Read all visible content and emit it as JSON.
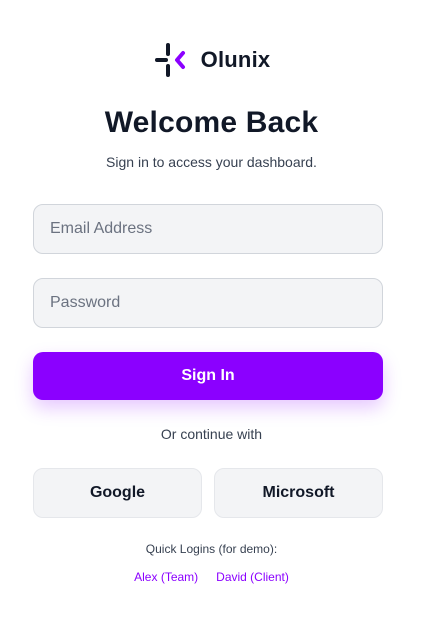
{
  "brand": {
    "name": "Olunix",
    "logo_icon": "plus-bracket-logo-icon",
    "accent_color": "#8B00FF"
  },
  "header": {
    "title": "Welcome Back",
    "subtitle": "Sign in to access your dashboard."
  },
  "form": {
    "email": {
      "value": "",
      "placeholder": "Email Address"
    },
    "password": {
      "value": "",
      "placeholder": "Password"
    },
    "submit_label": "Sign In",
    "submit_color": "#8B00FF"
  },
  "social": {
    "divider_text": "Or continue with",
    "google_label": "Google",
    "microsoft_label": "Microsoft"
  },
  "quick_logins": {
    "title": "Quick Logins (for demo):",
    "links": [
      "Alex (Team)",
      "David (Client)"
    ]
  }
}
